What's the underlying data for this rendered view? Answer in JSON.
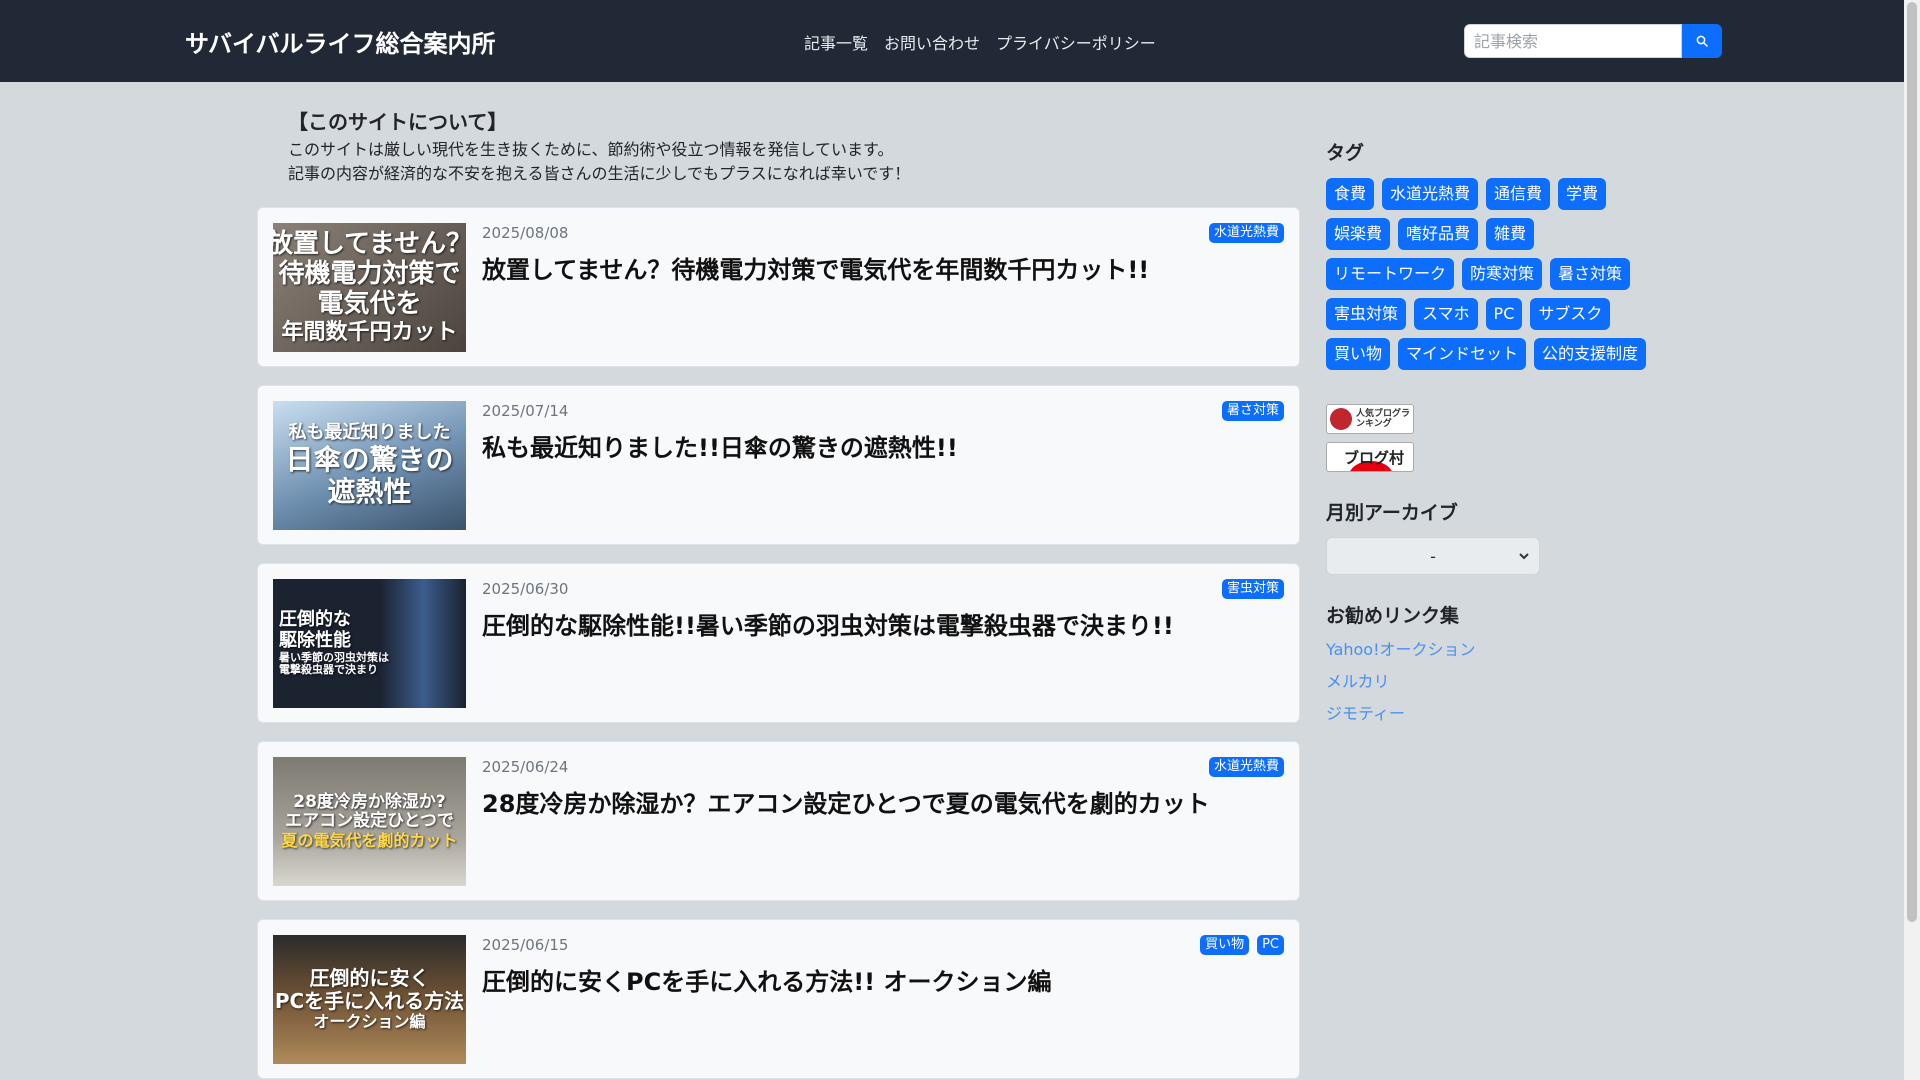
{
  "site": {
    "title": "サバイバルライフ総合案内所"
  },
  "nav": {
    "items": [
      "記事一覧",
      "お問い合わせ",
      "プライバシーポリシー"
    ]
  },
  "search": {
    "placeholder": "記事検索",
    "icon": "search-icon"
  },
  "about": {
    "title": "【このサイトについて】",
    "lines": [
      "このサイトは厳しい現代を生き抜くために、節約術や役立つ情報を発信しています。",
      "記事の内容が経済的な不安を抱える皆さんの生活に少しでもプラスになれば幸いです！"
    ]
  },
  "articles": [
    {
      "date": "2025/08/08",
      "title": "放置してません？待機電力対策で電気代を年間数千円カット!!",
      "tags": [
        "水道光熱費"
      ],
      "thumb": {
        "lines": [
          "放置してません？",
          "待機電力対策で",
          "電気代を",
          "年間数千円カット"
        ],
        "bg": "linear-gradient(135deg,#8b8178,#4b433d)"
      }
    },
    {
      "date": "2025/07/14",
      "title": "私も最近知りました!!日傘の驚きの遮熱性!!",
      "tags": [
        "暑さ対策"
      ],
      "thumb": {
        "lines": [
          "私も最近知りました",
          "日傘の驚きの",
          "遮熱性"
        ],
        "bg": "linear-gradient(160deg,#c9dff0,#6e8fb0 55%,#3b526b)"
      }
    },
    {
      "date": "2025/06/30",
      "title": "圧倒的な駆除性能!!暑い季節の羽虫対策は電撃殺虫器で決まり!!",
      "tags": [
        "害虫対策"
      ],
      "thumb": {
        "lines": [
          "圧倒的な",
          "駆除性能",
          "暑い季節の羽虫対策は",
          "電撃殺虫器で決まり"
        ],
        "bg": "linear-gradient(90deg,#1b2230 55%,#3b5d8c 78%,#1b2230)"
      }
    },
    {
      "date": "2025/06/24",
      "title": "28度冷房か除湿か？エアコン設定ひとつで夏の電気代を劇的カット",
      "tags": [
        "水道光熱費"
      ],
      "thumb": {
        "lines": [
          "28度冷房か除湿か?",
          "エアコン設定ひとつで",
          "夏の電気代を劇的カット"
        ],
        "bg": "linear-gradient(180deg,#7d7a72,#a7a39a 60%,#d9d6cf)"
      }
    },
    {
      "date": "2025/06/15",
      "title": "圧倒的に安くPCを手に入れる方法!! オークション編",
      "tags": [
        "買い物",
        "PC"
      ],
      "thumb": {
        "lines": [
          "圧倒的に安く",
          "PCを手に入れる方法",
          "オークション編"
        ],
        "bg": "linear-gradient(180deg,#2b2b2b,#6b5033 45%,#b08a5a)"
      }
    }
  ],
  "sidebar": {
    "tags_heading": "タグ",
    "tags": [
      "食費",
      "水道光熱費",
      "通信費",
      "学費",
      "娯楽費",
      "嗜好品費",
      "雑費",
      "リモートワーク",
      "防寒対策",
      "暑さ対策",
      "害虫対策",
      "スマホ",
      "PC",
      "サブスク",
      "買い物",
      "マインドセット",
      "公的支援制度"
    ],
    "banners": [
      {
        "text": "人気ブログランキング",
        "icon": "ranking-logo-icon"
      },
      {
        "text": "ブログ村",
        "icon": "blogmura-logo-icon"
      }
    ],
    "archive_heading": "月別アーカイブ",
    "archive_selected": "-",
    "links_heading": "お勧めリンク集",
    "links": [
      "Yahoo!オークション",
      "メルカリ",
      "ジモティー"
    ]
  },
  "colors": {
    "navbar": "#212936",
    "accent": "#0d6efd",
    "background": "#d3d9dd",
    "link": "#4a8ff0"
  }
}
